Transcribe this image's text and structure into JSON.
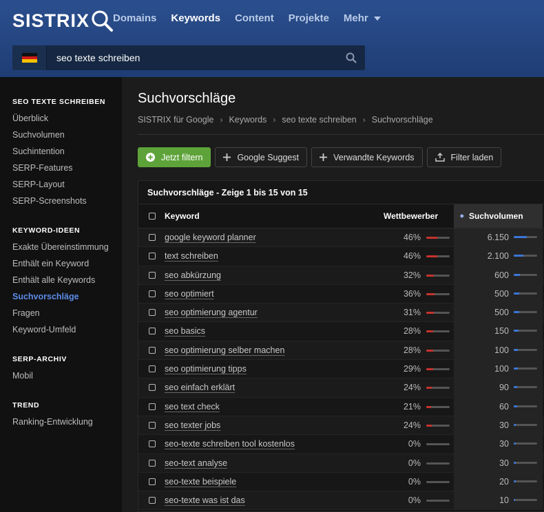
{
  "brand": {
    "name": "SISTRIX"
  },
  "nav": [
    {
      "label": "Domains",
      "active": false
    },
    {
      "label": "Keywords",
      "active": true
    },
    {
      "label": "Content",
      "active": false
    },
    {
      "label": "Projekte",
      "active": false
    },
    {
      "label": "Mehr",
      "active": false,
      "dropdown": true
    }
  ],
  "search": {
    "value": "seo texte schreiben",
    "country": "germany-flag"
  },
  "sidebar": [
    {
      "heading": "SEO TEXTE SCHREIBEN",
      "items": [
        {
          "label": "Überblick"
        },
        {
          "label": "Suchvolumen"
        },
        {
          "label": "Suchintention"
        },
        {
          "label": "SERP-Features"
        },
        {
          "label": "SERP-Layout"
        },
        {
          "label": "SERP-Screenshots"
        }
      ]
    },
    {
      "heading": "KEYWORD-IDEEN",
      "items": [
        {
          "label": "Exakte Übereinstimmung"
        },
        {
          "label": "Enthält ein Keyword"
        },
        {
          "label": "Enthält alle Keywords"
        },
        {
          "label": "Suchvorschläge",
          "active": true
        },
        {
          "label": "Fragen"
        },
        {
          "label": "Keyword-Umfeld"
        }
      ]
    },
    {
      "heading": "SERP-ARCHIV",
      "items": [
        {
          "label": "Mobil"
        }
      ]
    },
    {
      "heading": "TREND",
      "items": [
        {
          "label": "Ranking-Entwicklung"
        }
      ]
    }
  ],
  "page": {
    "title": "Suchvorschläge",
    "breadcrumb": [
      "SISTRIX für Google",
      "Keywords",
      "seo texte schreiben",
      "Suchvorschläge"
    ]
  },
  "toolbar": {
    "filter_label": "Jetzt filtern",
    "suggest_label": "Google Suggest",
    "related_label": "Verwandte Keywords",
    "load_label": "Filter laden"
  },
  "table": {
    "caption": "Suchvorschläge - Zeige 1 bis 15 von 15",
    "columns": {
      "keyword": "Keyword",
      "competition": "Wettbewerber",
      "volume": "Suchvolumen"
    },
    "rows": [
      {
        "keyword": "google keyword planner",
        "competition": "46%",
        "comp_value": 0.46,
        "volume": "6.150",
        "vol_value": 0.55
      },
      {
        "keyword": "text schreiben",
        "competition": "46%",
        "comp_value": 0.46,
        "volume": "2.100",
        "vol_value": 0.42
      },
      {
        "keyword": "seo abkürzung",
        "competition": "32%",
        "comp_value": 0.32,
        "volume": "600",
        "vol_value": 0.26
      },
      {
        "keyword": "seo optimiert",
        "competition": "36%",
        "comp_value": 0.36,
        "volume": "500",
        "vol_value": 0.24
      },
      {
        "keyword": "seo optimierung agentur",
        "competition": "31%",
        "comp_value": 0.31,
        "volume": "500",
        "vol_value": 0.24
      },
      {
        "keyword": "seo basics",
        "competition": "28%",
        "comp_value": 0.28,
        "volume": "150",
        "vol_value": 0.2
      },
      {
        "keyword": "seo optimierung selber machen",
        "competition": "28%",
        "comp_value": 0.28,
        "volume": "100",
        "vol_value": 0.18
      },
      {
        "keyword": "seo optimierung tipps",
        "competition": "29%",
        "comp_value": 0.29,
        "volume": "100",
        "vol_value": 0.18
      },
      {
        "keyword": "seo einfach erklärt",
        "competition": "24%",
        "comp_value": 0.24,
        "volume": "90",
        "vol_value": 0.16
      },
      {
        "keyword": "seo text check",
        "competition": "21%",
        "comp_value": 0.21,
        "volume": "60",
        "vol_value": 0.14
      },
      {
        "keyword": "seo texter jobs",
        "competition": "24%",
        "comp_value": 0.24,
        "volume": "30",
        "vol_value": 0.1
      },
      {
        "keyword": "seo-texte schreiben tool kostenlos",
        "competition": "0%",
        "comp_value": 0,
        "volume": "30",
        "vol_value": 0.1
      },
      {
        "keyword": "seo-text analyse",
        "competition": "0%",
        "comp_value": 0,
        "volume": "30",
        "vol_value": 0.1
      },
      {
        "keyword": "seo-texte beispiele",
        "competition": "0%",
        "comp_value": 0,
        "volume": "20",
        "vol_value": 0.08
      },
      {
        "keyword": "seo-texte was ist das",
        "competition": "0%",
        "comp_value": 0,
        "volume": "10",
        "vol_value": 0.06
      }
    ]
  },
  "colors": {
    "accent": "#5b8be8",
    "primary_button": "#5ea33a",
    "competition_bar": "#c8322e",
    "volume_bar": "#3b77d9",
    "header": "#2b4f8e"
  }
}
